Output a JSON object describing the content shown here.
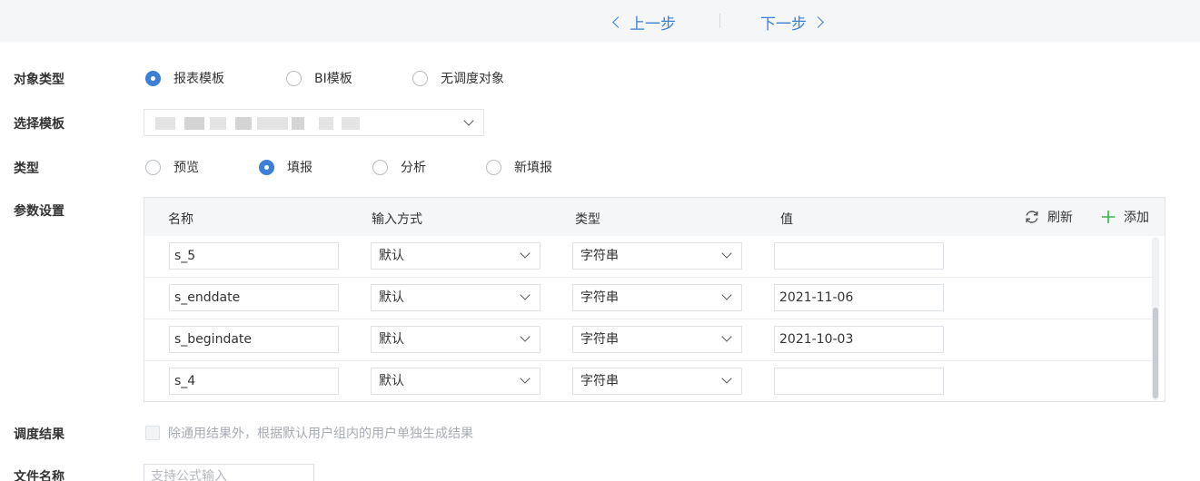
{
  "nav": {
    "prev_label": "上一步",
    "next_label": "下一步"
  },
  "form": {
    "object_type": {
      "label": "对象类型",
      "options": [
        "报表模板",
        "BI模板",
        "无调度对象"
      ],
      "selected": "报表模板"
    },
    "template": {
      "label": "选择模板"
    },
    "type": {
      "label": "类型",
      "options": [
        "预览",
        "填报",
        "分析",
        "新填报"
      ],
      "selected": "填报"
    },
    "params": {
      "label": "参数设置",
      "columns": [
        "名称",
        "输入方式",
        "类型",
        "值"
      ],
      "refresh_label": "刷新",
      "add_label": "添加",
      "rows": [
        {
          "name": "s_5",
          "input_method": "默认",
          "type": "字符串",
          "value": ""
        },
        {
          "name": "s_enddate",
          "input_method": "默认",
          "type": "字符串",
          "value": "2021-11-06"
        },
        {
          "name": "s_begindate",
          "input_method": "默认",
          "type": "字符串",
          "value": "2021-10-03"
        },
        {
          "name": "s_4",
          "input_method": "默认",
          "type": "字符串",
          "value": ""
        }
      ]
    },
    "schedule_result": {
      "label": "调度结果",
      "checkbox_label": "除通用结果外，根据默认用户组内的用户单独生成结果",
      "checked": false
    },
    "file_name": {
      "label": "文件名称",
      "placeholder": "支持公式输入"
    }
  },
  "colors": {
    "accent": "#3d7fd6",
    "header_bg": "#f5f6f8",
    "add_icon": "#3bb44a"
  },
  "icons": {
    "prev": "chevron-left-icon",
    "next": "chevron-right-icon",
    "refresh": "refresh-icon",
    "add": "plus-icon",
    "dropdown": "chevron-down-icon"
  }
}
